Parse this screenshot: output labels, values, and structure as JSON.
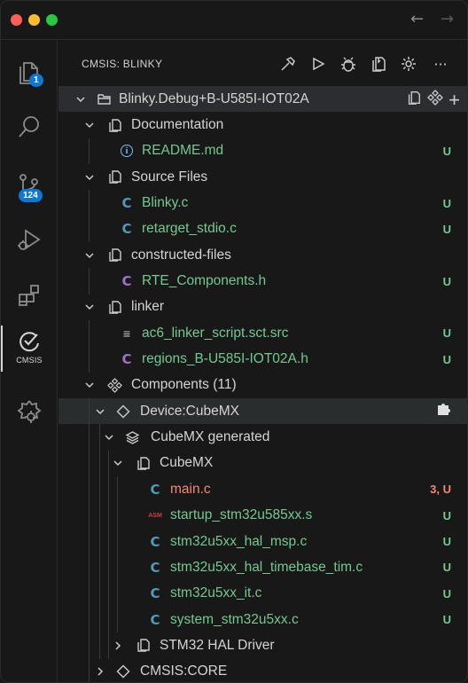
{
  "titlebar": {
    "back_icon": "arrow-left-icon",
    "forward_icon": "arrow-right-icon",
    "back_glyph": "←",
    "forward_glyph": "→"
  },
  "activity_bar": {
    "items": [
      {
        "name": "explorer",
        "icon": "files-icon",
        "badge": "1"
      },
      {
        "name": "search",
        "icon": "search-icon"
      },
      {
        "name": "source-control",
        "icon": "source-control-icon",
        "badge": "124"
      },
      {
        "name": "run-debug",
        "icon": "run-debug-icon"
      },
      {
        "name": "extensions",
        "icon": "extensions-icon"
      },
      {
        "name": "cmsis",
        "icon": "cmsis-icon",
        "label": "CMSIS",
        "active": true
      },
      {
        "name": "device-manager",
        "icon": "gear-cloud-icon"
      }
    ]
  },
  "panel": {
    "title": "CMSIS: BLINKY",
    "actions": [
      "hammer-icon",
      "play-icon",
      "bug-icon",
      "copy-file-icon",
      "gear-icon",
      "more-icon"
    ],
    "more_glyph": "···"
  },
  "tree": {
    "project": "Blinky.Debug+B-U585I-IOT02A",
    "groups": {
      "documentation": "Documentation",
      "readme": "README.md",
      "source_files": "Source Files",
      "blinky_c": "Blinky.c",
      "retarget": "retarget_stdio.c",
      "constructed": "constructed-files",
      "rte_components": "RTE_Components.h",
      "linker": "linker",
      "linker_script": "ac6_linker_script.sct.src",
      "regions": "regions_B-U585I-IOT02A.h",
      "components": "Components (11)",
      "device": "Device:CubeMX",
      "cubemx_generated": "CubeMX generated",
      "cubemx": "CubeMX",
      "main_c": "main.c",
      "startup": "startup_stm32u585xx.s",
      "hal_msp": "stm32u5xx_hal_msp.c",
      "hal_timebase": "stm32u5xx_hal_timebase_tim.c",
      "it_c": "stm32u5xx_it.c",
      "system_c": "system_stm32u5xx.c",
      "hal_driver": "STM32 HAL Driver",
      "cmsis_core": "CMSIS:CORE"
    },
    "status": {
      "untracked": "U",
      "main_c": "3, U"
    },
    "glyphs": {
      "c": "C",
      "asm": "ASM",
      "info": "i",
      "lines": "≡",
      "plus": "+"
    }
  },
  "colors": {
    "background": "#181818",
    "untracked": "#73c991",
    "error": "#f48771",
    "c_icon": "#519aba",
    "h_icon": "#a074c4",
    "badge": "#0a78d4"
  }
}
